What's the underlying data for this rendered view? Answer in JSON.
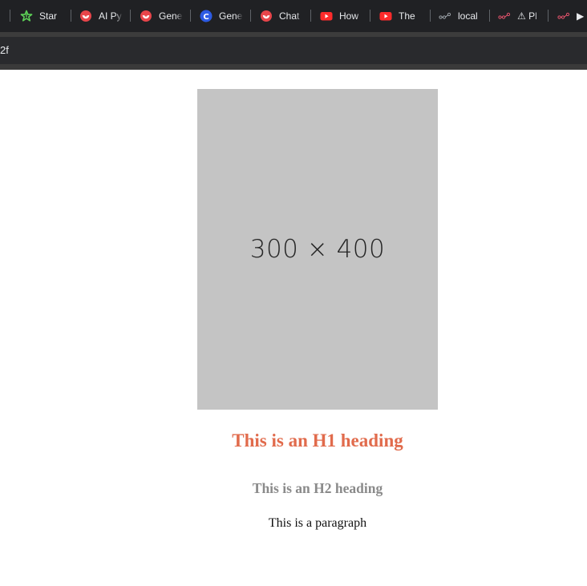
{
  "browser": {
    "tabs": [
      {
        "label": "Star",
        "icon": "star-outline-icon"
      },
      {
        "label": "AI Py",
        "icon": "red-spiral-icon"
      },
      {
        "label": "Gene",
        "icon": "red-spiral-icon"
      },
      {
        "label": "Gene",
        "icon": "blue-c-icon"
      },
      {
        "label": "Chat",
        "icon": "red-spiral-icon"
      },
      {
        "label": "How",
        "icon": "youtube-icon"
      },
      {
        "label": "The",
        "icon": "youtube-icon"
      },
      {
        "label": "local",
        "icon": "graph-icon"
      },
      {
        "label": "⚠ Pl",
        "icon": "graph-icon"
      },
      {
        "label": "▶",
        "icon": "graph-icon"
      }
    ],
    "address_text": "2f"
  },
  "page": {
    "image_placeholder_text": "300 × 400",
    "h1": "This is an H1 heading",
    "h2": "This is an H2 heading",
    "paragraph": "This is a paragraph"
  },
  "colors": {
    "h1": "#e16b4c",
    "h2": "#8a8a8a",
    "placeholder_bg": "#c4c4c4"
  }
}
